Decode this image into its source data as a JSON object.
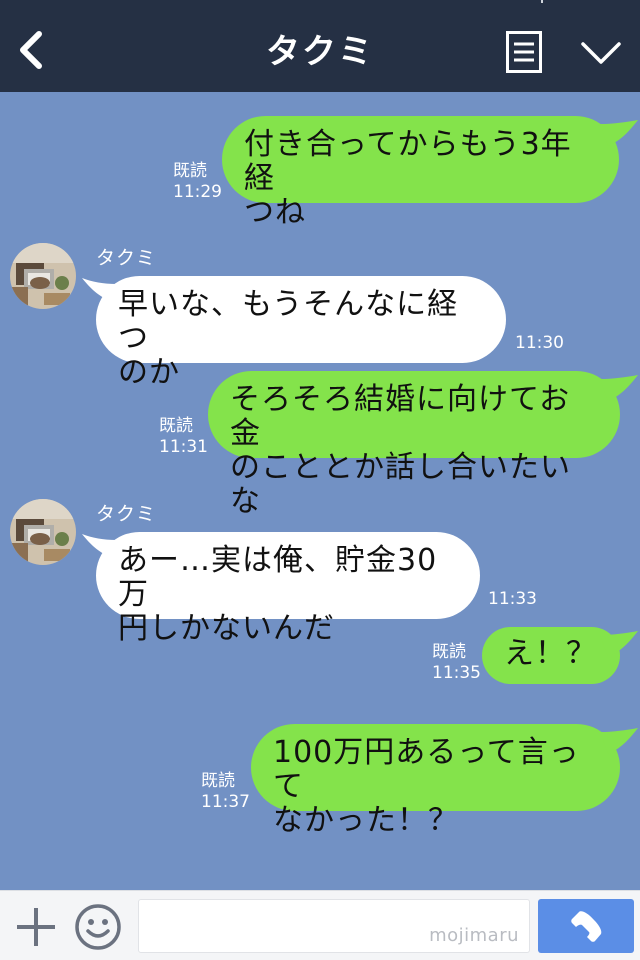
{
  "header": {
    "title": "タクミ",
    "back_icon": "back-chevron-icon",
    "note_icon": "notes-icon",
    "menu_icon": "chevron-down-icon",
    "background_color": "#253044"
  },
  "chat": {
    "background_color": "#7291c4",
    "outgoing_bubble_color": "#84e34b",
    "incoming_bubble_color": "#ffffff",
    "messages": [
      {
        "sender": "me",
        "line1": "付き合ってからもう3年経",
        "line2": "つね",
        "read_label": "既読",
        "time": "11:29"
      },
      {
        "sender": "タクミ",
        "line1": "早いな、もうそんなに経つ",
        "line2": "のか",
        "time": "11:30"
      },
      {
        "sender": "me",
        "line1": "そろそろ結婚に向けてお金",
        "line2": "のこととか話し合いたいな",
        "read_label": "既読",
        "time": "11:31"
      },
      {
        "sender": "タクミ",
        "line1": "あー…実は俺、貯金30万",
        "line2": "円しかないんだ",
        "time": "11:33"
      },
      {
        "sender": "me",
        "line1": "え！？",
        "read_label": "既読",
        "time": "11:35"
      },
      {
        "sender": "me",
        "line1": "100万円あるって言って",
        "line2": "なかった！？",
        "read_label": "既読",
        "time": "11:37"
      }
    ]
  },
  "footer": {
    "plus_icon": "plus-icon",
    "emoji_icon": "smiley-icon",
    "input_value": "",
    "watermark": "mojimaru",
    "call_icon": "phone-icon",
    "call_button_color": "#5b8ee6"
  }
}
